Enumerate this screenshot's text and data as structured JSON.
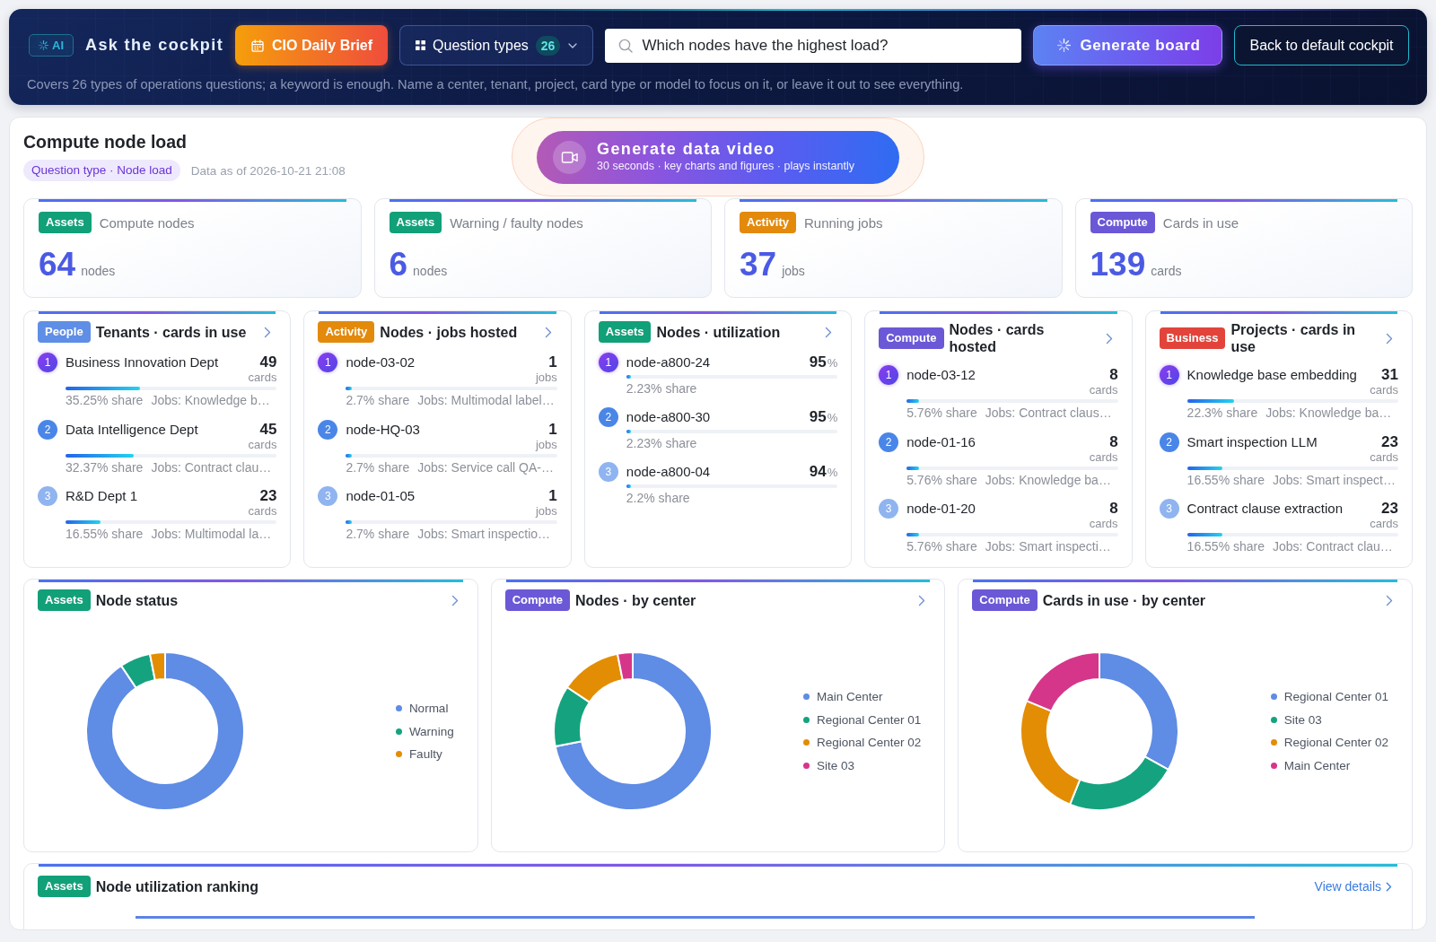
{
  "header": {
    "ai_badge": "AI",
    "title": "Ask the cockpit",
    "brief_button": "CIO Daily Brief",
    "question_types": {
      "label": "Question types",
      "count": "26"
    },
    "search": {
      "value": "Which nodes have the highest load?"
    },
    "generate_button": "Generate board",
    "back_button": "Back to default cockpit",
    "hint": "Covers 26 types of operations questions; a keyword is enough. Name a center, tenant, project, card type or model to focus on it, or leave it out to see everything."
  },
  "board": {
    "title": "Compute node load",
    "question_tag": "Question type · Node load",
    "data_time": "Data as of 2026-10-21 21:08",
    "video_button": {
      "title": "Generate data video",
      "subtitle": "30 seconds · key charts and figures · plays instantly"
    },
    "stats": [
      {
        "tag": {
          "label": "Assets",
          "color": "#12a079"
        },
        "label": "Compute nodes",
        "value": "64",
        "unit": "nodes"
      },
      {
        "tag": {
          "label": "Assets",
          "color": "#12a079"
        },
        "label": "Warning / faulty nodes",
        "value": "6",
        "unit": "nodes"
      },
      {
        "tag": {
          "label": "Activity",
          "color": "#e38a0c"
        },
        "label": "Running jobs",
        "value": "37",
        "unit": "jobs"
      },
      {
        "tag": {
          "label": "Compute",
          "color": "#6b58d6"
        },
        "label": "Cards in use",
        "value": "139",
        "unit": "cards"
      }
    ],
    "lists": [
      {
        "tag": {
          "label": "People",
          "color": "#5e8ee6"
        },
        "title": "Tenants · cards in use",
        "kind": "count",
        "items": [
          {
            "rank": "1",
            "name": "Business Innovation Dept",
            "value": "49",
            "unit": "cards",
            "level": 0.3525,
            "share": "35.25% share",
            "jobs": "Jobs: Knowledge b…"
          },
          {
            "rank": "2",
            "name": "Data Intelligence Dept",
            "value": "45",
            "unit": "cards",
            "level": 0.3237,
            "share": "32.37% share",
            "jobs": "Jobs: Contract clau…"
          },
          {
            "rank": "3",
            "name": "R&D Dept 1",
            "value": "23",
            "unit": "cards",
            "level": 0.1655,
            "share": "16.55% share",
            "jobs": "Jobs: Multimodal la…"
          }
        ]
      },
      {
        "tag": {
          "label": "Activity",
          "color": "#e38a0c"
        },
        "title": "Nodes · jobs hosted",
        "kind": "count",
        "items": [
          {
            "rank": "1",
            "name": "node-03-02",
            "value": "1",
            "unit": "jobs",
            "level": 0.027,
            "share": "2.7% share",
            "jobs": "Jobs: Multimodal label…"
          },
          {
            "rank": "2",
            "name": "node-HQ-03",
            "value": "1",
            "unit": "jobs",
            "level": 0.027,
            "share": "2.7% share",
            "jobs": "Jobs: Service call QA-…"
          },
          {
            "rank": "3",
            "name": "node-01-05",
            "value": "1",
            "unit": "jobs",
            "level": 0.027,
            "share": "2.7% share",
            "jobs": "Jobs: Smart inspectio…"
          }
        ]
      },
      {
        "tag": {
          "label": "Assets",
          "color": "#12a079"
        },
        "title": "Nodes · utilization",
        "kind": "percent",
        "items": [
          {
            "rank": "1",
            "name": "node-a800-24",
            "value": "95",
            "unit": "%",
            "level": 0.0223,
            "share": "2.23% share"
          },
          {
            "rank": "2",
            "name": "node-a800-30",
            "value": "95",
            "unit": "%",
            "level": 0.0223,
            "share": "2.23% share"
          },
          {
            "rank": "3",
            "name": "node-a800-04",
            "value": "94",
            "unit": "%",
            "level": 0.022,
            "share": "2.2% share"
          }
        ]
      },
      {
        "tag": {
          "label": "Compute",
          "color": "#6b58d6"
        },
        "title": "Nodes · cards hosted",
        "kind": "count",
        "items": [
          {
            "rank": "1",
            "name": "node-03-12",
            "value": "8",
            "unit": "cards",
            "level": 0.0576,
            "share": "5.76% share",
            "jobs": "Jobs: Contract claus…"
          },
          {
            "rank": "2",
            "name": "node-01-16",
            "value": "8",
            "unit": "cards",
            "level": 0.0576,
            "share": "5.76% share",
            "jobs": "Jobs: Knowledge ba…"
          },
          {
            "rank": "3",
            "name": "node-01-20",
            "value": "8",
            "unit": "cards",
            "level": 0.0576,
            "share": "5.76% share",
            "jobs": "Jobs: Smart inspecti…"
          }
        ]
      },
      {
        "tag": {
          "label": "Business",
          "color": "#e2443b"
        },
        "title": "Projects · cards in use",
        "kind": "count",
        "items": [
          {
            "rank": "1",
            "name": "Knowledge base embedding",
            "value": "31",
            "unit": "cards",
            "level": 0.223,
            "share": "22.3% share",
            "jobs": "Jobs: Knowledge ba…"
          },
          {
            "rank": "2",
            "name": "Smart inspection LLM",
            "value": "23",
            "unit": "cards",
            "level": 0.1655,
            "share": "16.55% share",
            "jobs": "Jobs: Smart inspect…"
          },
          {
            "rank": "3",
            "name": "Contract clause extraction",
            "value": "23",
            "unit": "cards",
            "level": 0.1655,
            "share": "16.55% share",
            "jobs": "Jobs: Contract clau…"
          }
        ]
      }
    ],
    "charts": [
      {
        "tag": {
          "label": "Assets",
          "color": "#12a079"
        },
        "title": "Node status",
        "chart_data": {
          "type": "donut",
          "categories": [
            "Normal",
            "Warning",
            "Faulty"
          ],
          "values": [
            90.6,
            6.3,
            3.1
          ],
          "colors": [
            "#5f8ce4",
            "#15a37f",
            "#e38d05"
          ]
        }
      },
      {
        "tag": {
          "label": "Compute",
          "color": "#6b58d6"
        },
        "title": "Nodes · by center",
        "chart_data": {
          "type": "donut",
          "categories": [
            "Main Center",
            "Regional Center 01",
            "Regional Center 02",
            "Site 03"
          ],
          "values": [
            71.9,
            12.5,
            12.5,
            3.1
          ],
          "colors": [
            "#5f8ce4",
            "#15a37f",
            "#e38d05",
            "#d5368a"
          ]
        }
      },
      {
        "tag": {
          "label": "Compute",
          "color": "#6b58d6"
        },
        "title": "Cards in use · by center",
        "chart_data": {
          "type": "donut",
          "categories": [
            "Regional Center 01",
            "Site 03",
            "Regional Center 02",
            "Main Center"
          ],
          "values": [
            33.1,
            23.0,
            25.2,
            18.7
          ],
          "colors": [
            "#5f8ce4",
            "#15a37f",
            "#e38d05",
            "#d5368a"
          ]
        }
      }
    ],
    "ranking": {
      "tag": {
        "label": "Assets",
        "color": "#12a079"
      },
      "title": "Node utilization ranking",
      "link": "View details"
    }
  }
}
